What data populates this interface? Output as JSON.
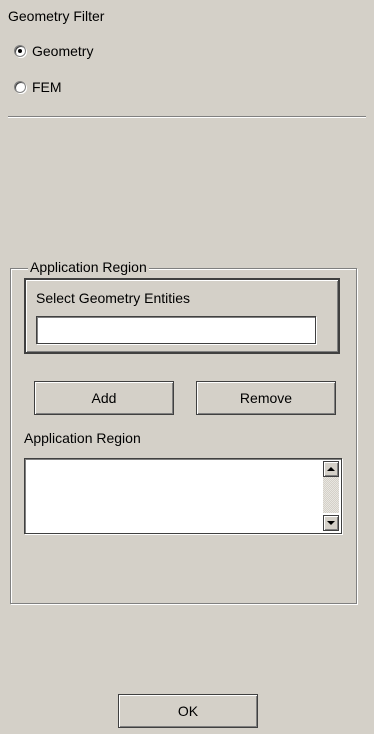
{
  "geometry_filter": {
    "label": "Geometry Filter",
    "options": [
      {
        "label": "Geometry",
        "selected": true
      },
      {
        "label": "FEM",
        "selected": false
      }
    ]
  },
  "application_region_group": {
    "title": "Application Region",
    "select_entities": {
      "label": "Select Geometry Entities",
      "value": ""
    },
    "add_label": "Add",
    "remove_label": "Remove",
    "list_label": "Application Region",
    "list_items": []
  },
  "ok_label": "OK",
  "icons": {
    "scroll_up": "triangle-up-icon",
    "scroll_down": "triangle-down-icon"
  },
  "colors": {
    "panel_background": "#d4d0c8",
    "field_background": "#ffffff"
  }
}
